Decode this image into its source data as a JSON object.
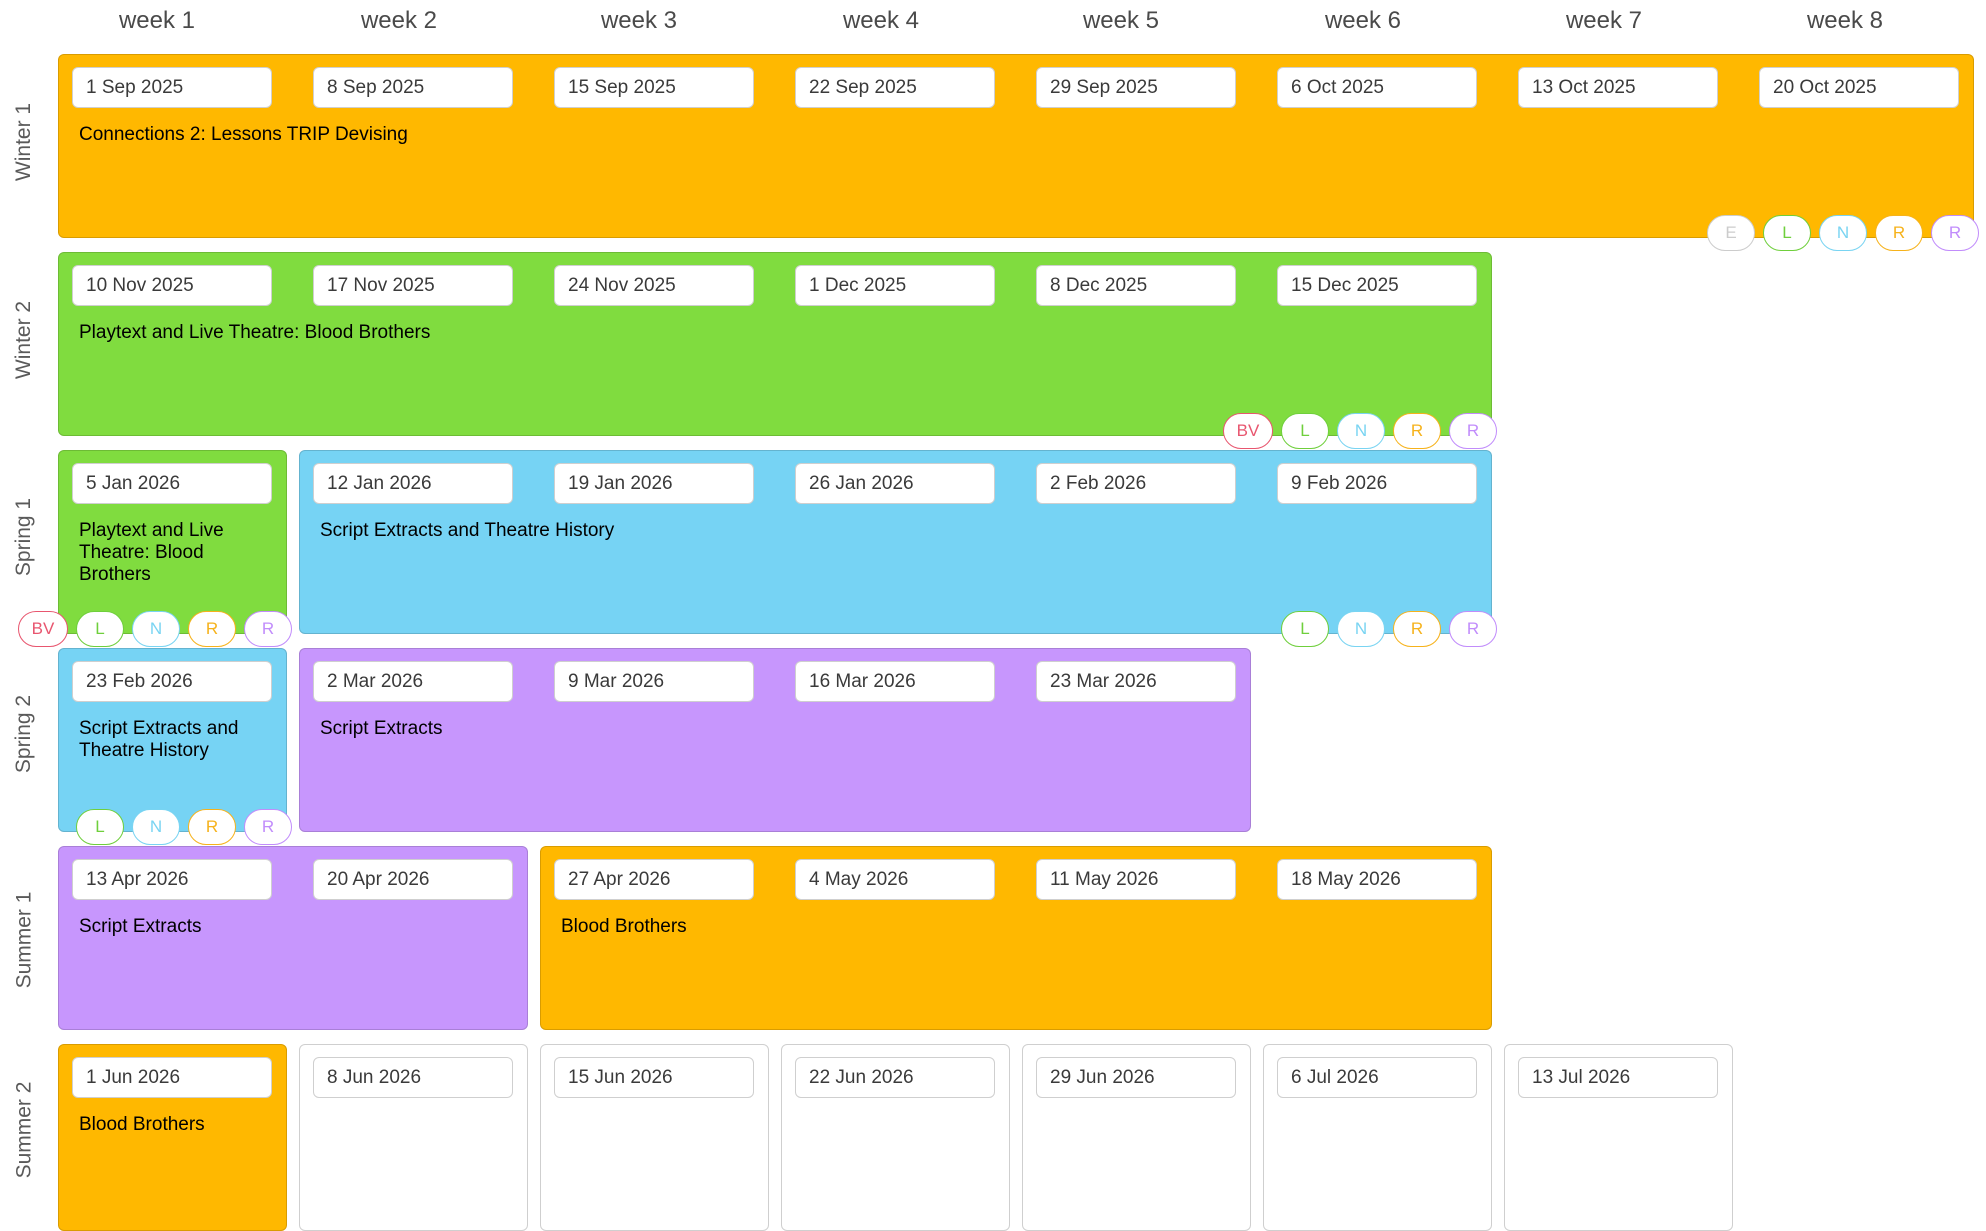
{
  "weeks": [
    "week 1",
    "week 2",
    "week 3",
    "week 4",
    "week 5",
    "week 6",
    "week 7",
    "week 8"
  ],
  "colors": {
    "orange": "#FFB800",
    "green": "#80DC3F",
    "blue": "#76D3F4",
    "purple": "#C796FD",
    "badge_E": "#cccccc",
    "badge_L": "#6fcf3c",
    "badge_N": "#79d4f2",
    "badge_R_orange": "#f6b21b",
    "badge_R_purple": "#c18cfb",
    "badge_BV": "#e8566f"
  },
  "terms": [
    {
      "label": "Winter 1"
    },
    {
      "label": "Winter 2"
    },
    {
      "label": "Spring 1"
    },
    {
      "label": "Spring 2"
    },
    {
      "label": "Summer 1"
    },
    {
      "label": "Summer 2"
    }
  ],
  "blocks": [
    {
      "term": 0,
      "start": 0,
      "span": 8,
      "color": "orange",
      "title": "Connections 2: Lessons TRIP Devising",
      "dates": [
        "1 Sep 2025",
        "8 Sep 2025",
        "15 Sep 2025",
        "22 Sep 2025",
        "29 Sep 2025",
        "6 Oct 2025",
        "13 Oct 2025",
        "20 Oct 2025"
      ],
      "badges": [
        "E",
        "L",
        "N",
        "R",
        "R"
      ]
    },
    {
      "term": 1,
      "start": 0,
      "span": 6,
      "color": "green",
      "title": "Playtext and Live Theatre: Blood Brothers",
      "dates": [
        "10 Nov 2025",
        "17 Nov 2025",
        "24 Nov 2025",
        "1 Dec 2025",
        "8 Dec 2025",
        "15 Dec 2025"
      ],
      "badges": [
        "BV",
        "L",
        "N",
        "R",
        "R"
      ]
    },
    {
      "term": 2,
      "start": 0,
      "span": 1,
      "color": "green",
      "title": "Playtext and Live Theatre: Blood Brothers",
      "dates": [
        "5 Jan 2026"
      ],
      "badges": [
        "BV",
        "L",
        "N",
        "R",
        "R"
      ]
    },
    {
      "term": 2,
      "start": 1,
      "span": 5,
      "color": "blue",
      "title": "Script Extracts and Theatre History",
      "dates": [
        "12 Jan 2026",
        "19 Jan 2026",
        "26 Jan 2026",
        "2 Feb 2026",
        "9 Feb 2026"
      ],
      "badges": [
        "L",
        "N",
        "R",
        "R"
      ]
    },
    {
      "term": 3,
      "start": 0,
      "span": 1,
      "color": "blue",
      "title": "Script Extracts and Theatre History",
      "dates": [
        "23 Feb 2026"
      ],
      "badges": [
        "L",
        "N",
        "R",
        "R"
      ]
    },
    {
      "term": 3,
      "start": 1,
      "span": 4,
      "color": "purple",
      "title": "Script Extracts",
      "dates": [
        "2 Mar 2026",
        "9 Mar 2026",
        "16 Mar 2026",
        "23 Mar 2026"
      ],
      "badges": []
    },
    {
      "term": 4,
      "start": 0,
      "span": 2,
      "color": "purple",
      "title": "Script Extracts",
      "dates": [
        "13 Apr 2026",
        "20 Apr 2026"
      ],
      "badges": []
    },
    {
      "term": 4,
      "start": 2,
      "span": 4,
      "color": "orange",
      "title": "Blood Brothers",
      "dates": [
        "27 Apr 2026",
        "4 May 2026",
        "11 May 2026",
        "18 May 2026"
      ],
      "badges": []
    },
    {
      "term": 5,
      "start": 0,
      "span": 1,
      "color": "orange",
      "title": "Blood Brothers",
      "dates": [
        "1 Jun 2026"
      ],
      "badges": []
    },
    {
      "term": 5,
      "start": 1,
      "span": 1,
      "color": "empty",
      "title": "",
      "dates": [
        "8 Jun 2026"
      ],
      "badges": []
    },
    {
      "term": 5,
      "start": 2,
      "span": 1,
      "color": "empty",
      "title": "",
      "dates": [
        "15 Jun 2026"
      ],
      "badges": []
    },
    {
      "term": 5,
      "start": 3,
      "span": 1,
      "color": "empty",
      "title": "",
      "dates": [
        "22 Jun 2026"
      ],
      "badges": []
    },
    {
      "term": 5,
      "start": 4,
      "span": 1,
      "color": "empty",
      "title": "",
      "dates": [
        "29 Jun 2026"
      ],
      "badges": []
    },
    {
      "term": 5,
      "start": 5,
      "span": 1,
      "color": "empty",
      "title": "",
      "dates": [
        "6 Jul 2026"
      ],
      "badges": []
    },
    {
      "term": 5,
      "start": 6,
      "span": 1,
      "color": "empty",
      "title": "",
      "dates": [
        "13 Jul 2026"
      ],
      "badges": []
    }
  ]
}
